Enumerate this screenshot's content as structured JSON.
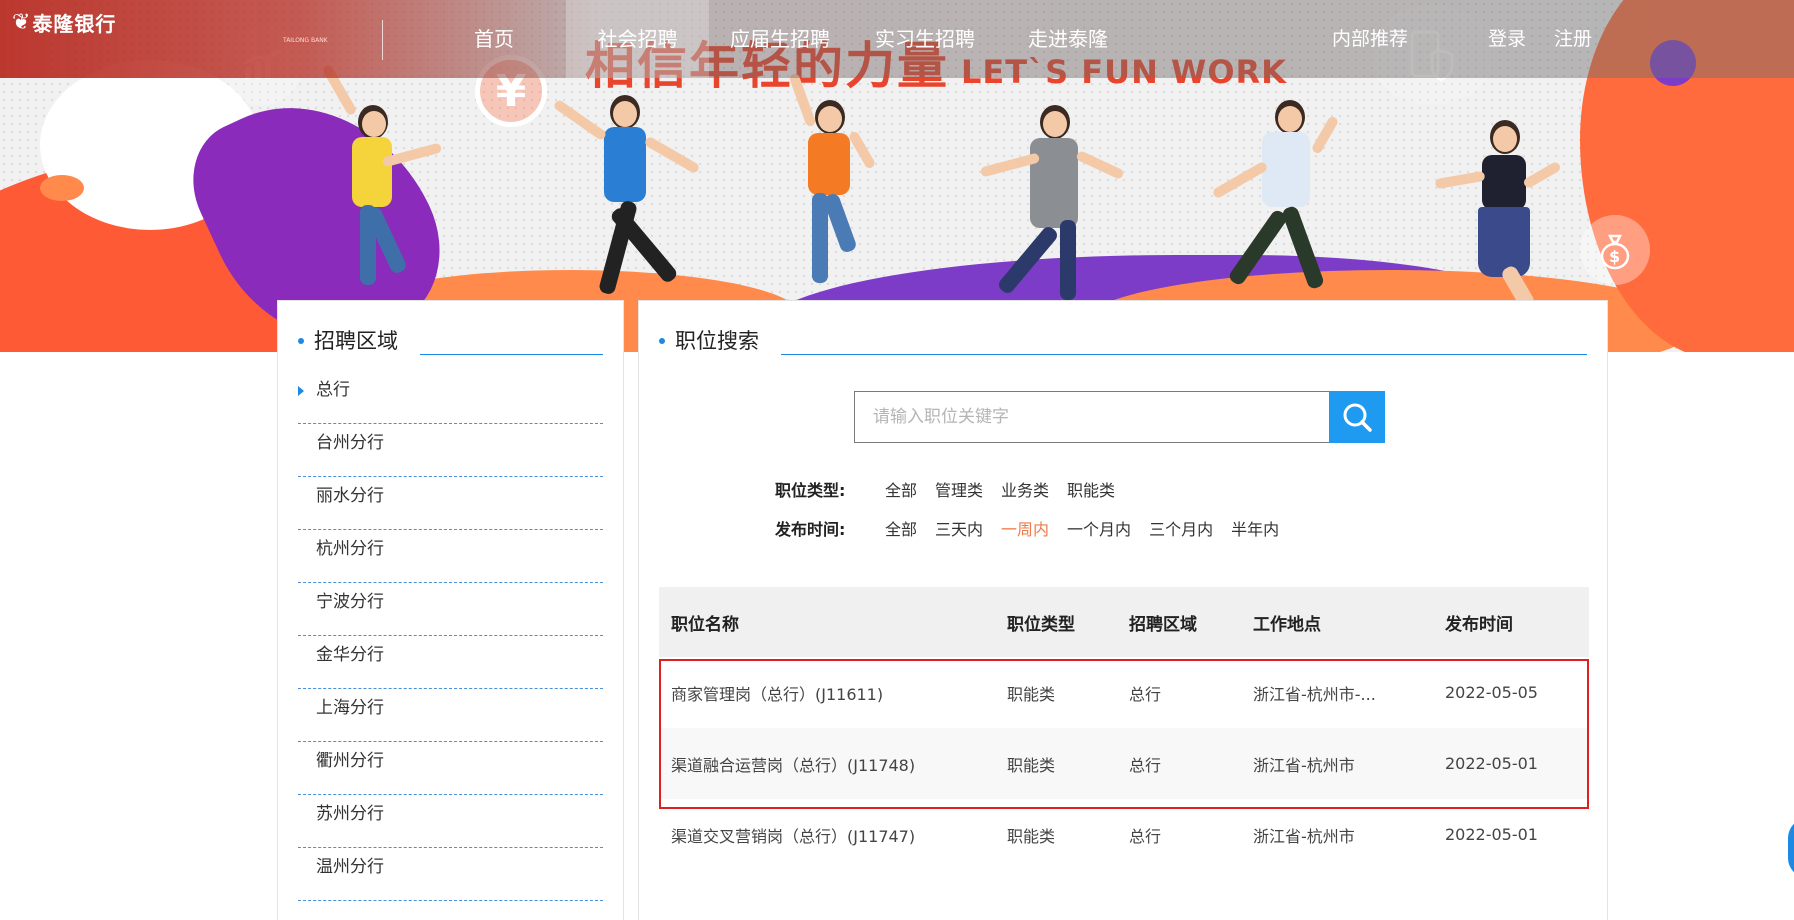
{
  "brand": {
    "name": "泰隆银行",
    "subtitle": "TAILONG BANK"
  },
  "hero": {
    "slogan_cn": "相信年轻的力量",
    "slogan_en": "LET`S FUN WORK"
  },
  "nav": {
    "items": [
      {
        "label": "首页",
        "active": false
      },
      {
        "label": "社会招聘",
        "active": true
      },
      {
        "label": "应届生招聘",
        "active": false
      },
      {
        "label": "实习生招聘",
        "active": false
      },
      {
        "label": "走进泰隆",
        "active": false
      }
    ],
    "referral": "内部推荐",
    "login": "登录",
    "register": "注册"
  },
  "regions": {
    "title": "招聘区域",
    "items": [
      "总行",
      "台州分行",
      "丽水分行",
      "杭州分行",
      "宁波分行",
      "金华分行",
      "上海分行",
      "衢州分行",
      "苏州分行",
      "温州分行"
    ],
    "selected": "总行"
  },
  "search": {
    "title": "职位搜索",
    "placeholder": "请输入职位关键字",
    "value": ""
  },
  "filters": {
    "type_label": "职位类型:",
    "type_options": [
      "全部",
      "管理类",
      "业务类",
      "职能类"
    ],
    "time_label": "发布时间:",
    "time_options": [
      "全部",
      "三天内",
      "一周内",
      "一个月内",
      "三个月内",
      "半年内"
    ],
    "time_selected": "一周内"
  },
  "table": {
    "headers": [
      "职位名称",
      "职位类型",
      "招聘区域",
      "工作地点",
      "发布时间"
    ],
    "rows": [
      [
        "商家管理岗（总行）(J11611)",
        "职能类",
        "总行",
        "浙江省-杭州市-...",
        "2022-05-05"
      ],
      [
        "渠道融合运营岗（总行）(J11748)",
        "职能类",
        "总行",
        "浙江省-杭州市",
        "2022-05-01"
      ],
      [
        "渠道交叉营销岗（总行）(J11747)",
        "职能类",
        "总行",
        "浙江省-杭州市",
        "2022-05-01"
      ]
    ]
  },
  "colors": {
    "accent": "#1e88e5",
    "selected_filter": "#f07a4a",
    "highlight_border": "#e02020",
    "brand_red": "#b41e14"
  }
}
